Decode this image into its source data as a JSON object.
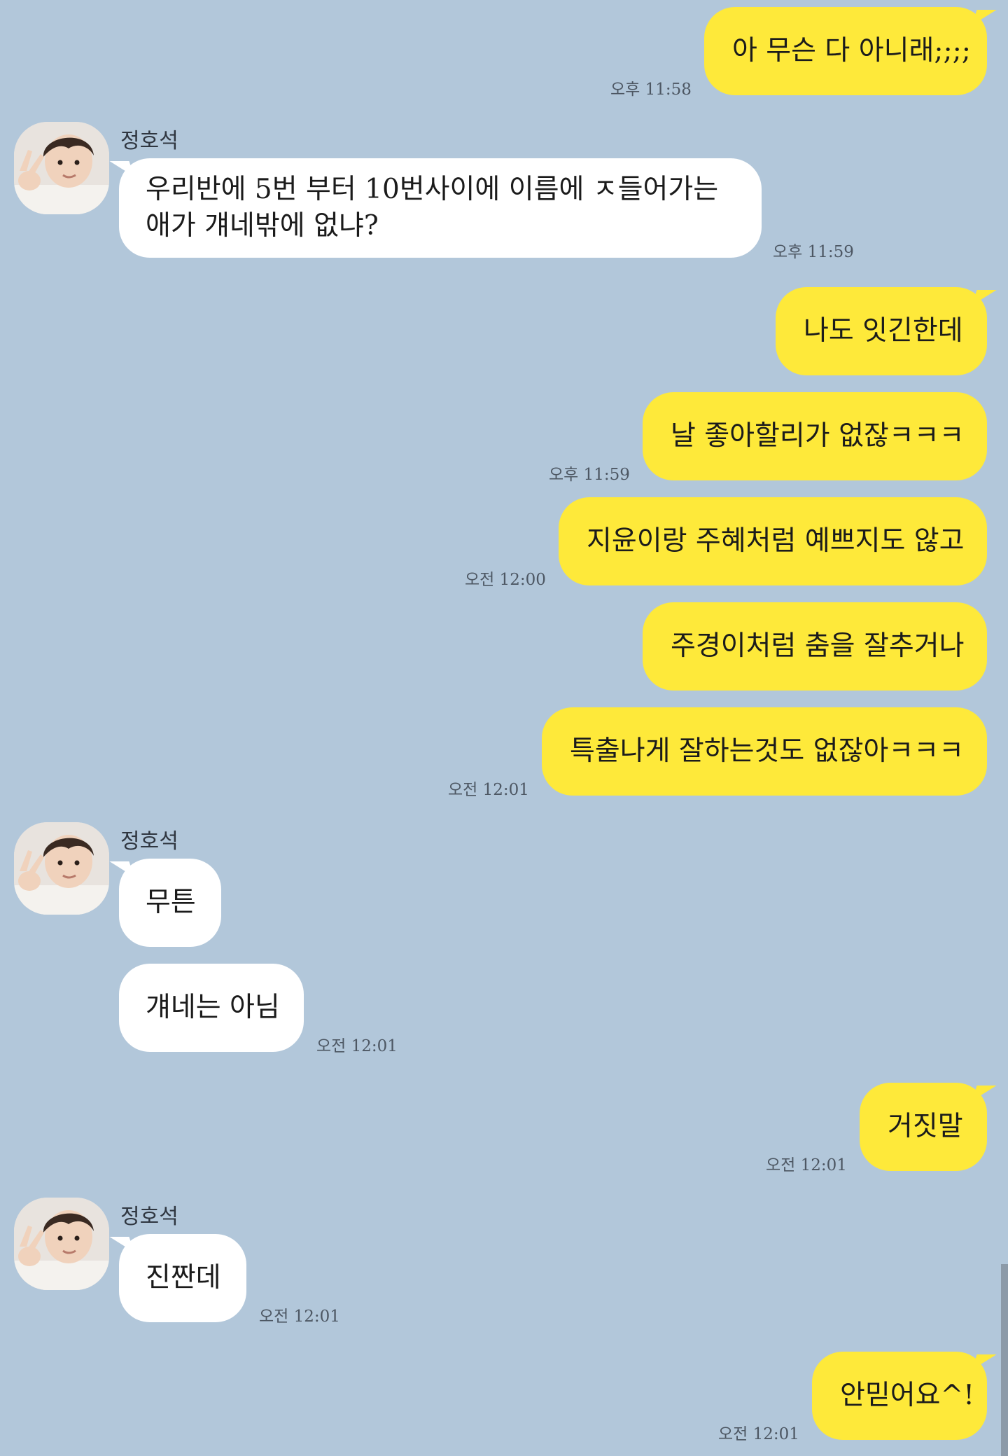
{
  "chat": {
    "contact_name": "정호석",
    "messages": [
      {
        "from": "me",
        "text": "아 무슨 다 아니래;;;;",
        "time": "오후 11:58"
      },
      {
        "from": "other",
        "sender": "정호석",
        "text": "우리반에 5번 부터 10번사이에 이름에 ㅈ들어가는 애가 걔네밖에 없냐?",
        "time": "오후 11:59"
      },
      {
        "from": "me",
        "text": "나도 잇긴한데"
      },
      {
        "from": "me",
        "text": "날 좋아할리가 없잖ㅋㅋㅋ",
        "time": "오후 11:59"
      },
      {
        "from": "me",
        "text": "지윤이랑 주혜처럼 예쁘지도 않고",
        "time": "오전 12:00"
      },
      {
        "from": "me",
        "text": "주경이처럼 춤을 잘추거나"
      },
      {
        "from": "me",
        "text": "특출나게 잘하는것도 없잖아ㅋㅋㅋ",
        "time": "오전 12:01"
      },
      {
        "from": "other",
        "sender": "정호석",
        "text": "무튼"
      },
      {
        "from": "other",
        "text": "걔네는 아님",
        "time": "오전 12:01"
      },
      {
        "from": "me",
        "text": "거짓말",
        "time": "오전 12:01"
      },
      {
        "from": "other",
        "sender": "정호석",
        "text": "진짠데",
        "time": "오전 12:01"
      },
      {
        "from": "me",
        "text": "안믿어요^!",
        "time": "오전 12:01"
      }
    ]
  },
  "colors": {
    "background": "#b2c7da",
    "my_bubble": "#fee93a",
    "their_bubble": "#ffffff"
  },
  "icons": {
    "avatar": "profile-photo"
  }
}
